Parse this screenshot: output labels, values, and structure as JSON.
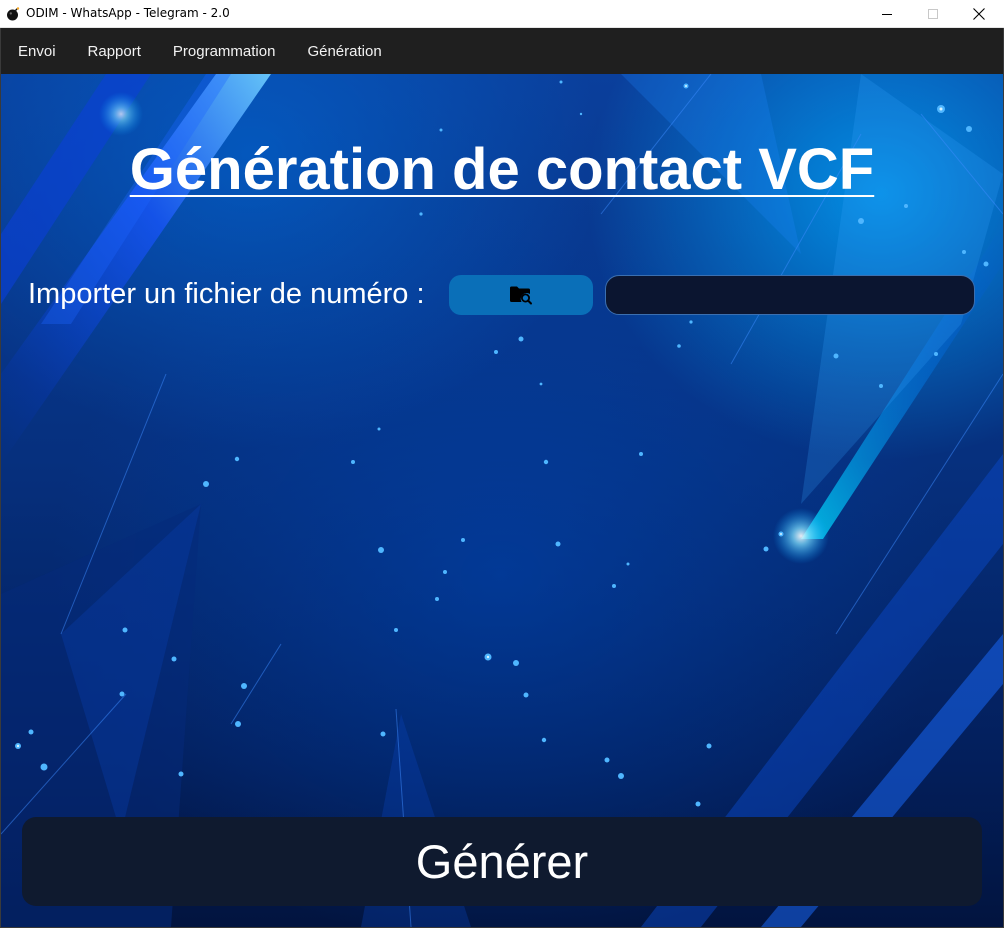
{
  "window": {
    "title": "ODIM - WhatsApp - Telegram - 2.0",
    "icon": "bomb-icon",
    "controls": [
      "minimize-icon",
      "maximize-icon",
      "close-icon"
    ]
  },
  "menu": {
    "items": [
      {
        "label": "Envoi"
      },
      {
        "label": "Rapport"
      },
      {
        "label": "Programmation"
      },
      {
        "label": "Génération"
      }
    ]
  },
  "main": {
    "title": "Génération de contact VCF",
    "import_label": "Importer un fichier de numéro :",
    "browse_icon": "folder-search-icon",
    "file_path_value": "",
    "generate_label": "Générer"
  },
  "colors": {
    "menubar": "#1f1f1f",
    "browse_button": "#0a6fb8",
    "file_field": "#0b1530",
    "generate_button": "#0f1a2f",
    "background_top": "#0a3f9c",
    "background_bottom": "#02143f",
    "accent": "#00b4ff"
  }
}
